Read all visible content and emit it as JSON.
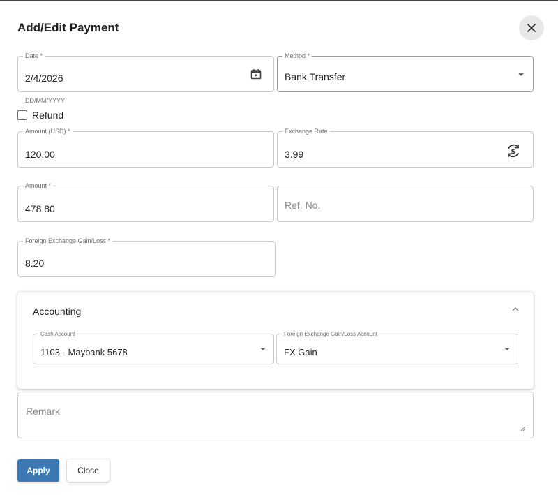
{
  "dialog": {
    "title": "Add/Edit Payment",
    "close_icon": "close-icon"
  },
  "date": {
    "label": "Date *",
    "value": "2/4/2026",
    "helper": "DD/MM/YYYY",
    "icon": "calendar-icon"
  },
  "method": {
    "label": "Method *",
    "value": "Bank Transfer"
  },
  "refund": {
    "label": "Refund",
    "checked": false
  },
  "amount_usd": {
    "label": "Amount (USD) *",
    "value": "120.00"
  },
  "exchange_rate": {
    "label": "Exchange Rate",
    "value": "3.99",
    "icon": "currency-exchange-icon"
  },
  "amount": {
    "label": "Amount *",
    "value": "478.80"
  },
  "ref_no": {
    "placeholder": "Ref. No."
  },
  "fx_gain_loss": {
    "label": "Foreign Exchange Gain/Loss *",
    "value": "8.20"
  },
  "accounting": {
    "title": "Accounting",
    "cash_account": {
      "label": "Cash Account",
      "value": "1103 - Maybank 5678"
    },
    "fx_account": {
      "label": "Foreign Exchange Gain/Loss Account",
      "value": "FX Gain"
    }
  },
  "remark": {
    "placeholder": "Remark"
  },
  "actions": {
    "apply_label": "Apply",
    "close_label": "Close"
  },
  "colors": {
    "primary_button": "#3b78b4",
    "border": "#c9c9c9"
  }
}
